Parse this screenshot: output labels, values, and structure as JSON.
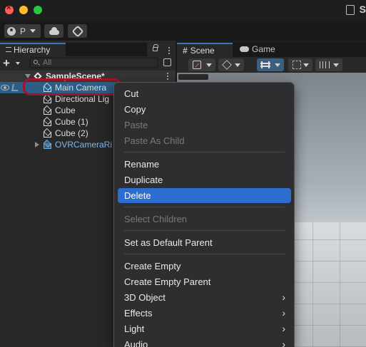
{
  "app": {
    "title_partial": "S"
  },
  "toolbar": {
    "account_label": "P",
    "account_icon": "account-avatar-icon",
    "cloud_icon": "cloud-icon",
    "collab_icon": "collab-icon"
  },
  "hierarchy": {
    "tab_label": "Hierarchy",
    "search_placeholder": "All",
    "scene_name": "SampleScene*",
    "items": [
      {
        "label": "Main Camera",
        "selected": true,
        "prefab": false
      },
      {
        "label": "Directional Lig",
        "selected": false,
        "prefab": false
      },
      {
        "label": "Cube",
        "selected": false,
        "prefab": false
      },
      {
        "label": "Cube (1)",
        "selected": false,
        "prefab": false
      },
      {
        "label": "Cube (2)",
        "selected": false,
        "prefab": false
      },
      {
        "label": "OVRCameraRi",
        "selected": false,
        "prefab": true
      }
    ]
  },
  "scene_panel": {
    "tabs": [
      {
        "label": "Scene",
        "active": true
      },
      {
        "label": "Game",
        "active": false
      }
    ]
  },
  "context_menu": {
    "groups": [
      [
        {
          "label": "Cut",
          "enabled": true
        },
        {
          "label": "Copy",
          "enabled": true
        },
        {
          "label": "Paste",
          "enabled": false
        },
        {
          "label": "Paste As Child",
          "enabled": false
        }
      ],
      [
        {
          "label": "Rename",
          "enabled": true
        },
        {
          "label": "Duplicate",
          "enabled": true
        },
        {
          "label": "Delete",
          "enabled": true,
          "highlighted": true
        }
      ],
      [
        {
          "label": "Select Children",
          "enabled": false
        }
      ],
      [
        {
          "label": "Set as Default Parent",
          "enabled": true
        }
      ],
      [
        {
          "label": "Create Empty",
          "enabled": true
        },
        {
          "label": "Create Empty Parent",
          "enabled": true
        },
        {
          "label": "3D Object",
          "enabled": true,
          "submenu": true
        },
        {
          "label": "Effects",
          "enabled": true,
          "submenu": true
        },
        {
          "label": "Light",
          "enabled": true,
          "submenu": true
        },
        {
          "label": "Audio",
          "enabled": true,
          "submenu": true
        }
      ]
    ]
  },
  "colors": {
    "selection": "#2c5d87",
    "menu_highlight": "#2c6ecf",
    "annotation_ring": "#a3122b",
    "prefab_text": "#7fb8ef"
  }
}
